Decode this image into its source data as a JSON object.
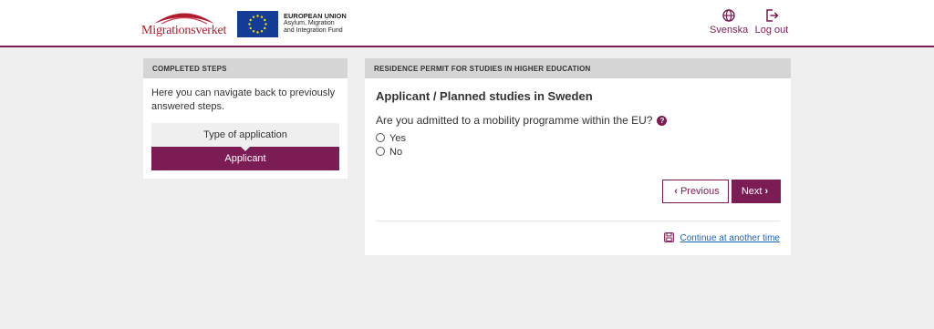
{
  "header": {
    "logo_text": "Migrationsverket",
    "eu": {
      "line1": "EUROPEAN UNION",
      "line2": "Asylum, Migration",
      "line3": "and Integration Fund"
    },
    "language_label": "Svenska",
    "logout_label": "Log out",
    "icons": [
      "globe-icon",
      "logout-icon"
    ]
  },
  "sidebar": {
    "heading": "COMPLETED STEPS",
    "intro": "Here you can navigate back to previously answered steps.",
    "steps": [
      {
        "label": "Type of application",
        "state": "done"
      },
      {
        "label": "Applicant",
        "state": "current"
      }
    ]
  },
  "main": {
    "heading": "RESIDENCE PERMIT FOR STUDIES IN HIGHER EDUCATION",
    "title": "Applicant / Planned studies in Sweden",
    "question": "Are you admitted to a mobility programme within the EU?",
    "options": [
      "Yes",
      "No"
    ],
    "previous_label": "Previous",
    "next_label": "Next",
    "continue_label": "Continue at another time"
  },
  "colors": {
    "accent": "#7b1c54",
    "background": "#f0eff0",
    "link": "#1a63b8",
    "logo_red": "#b01c2e",
    "eu_blue": "#123c96"
  }
}
